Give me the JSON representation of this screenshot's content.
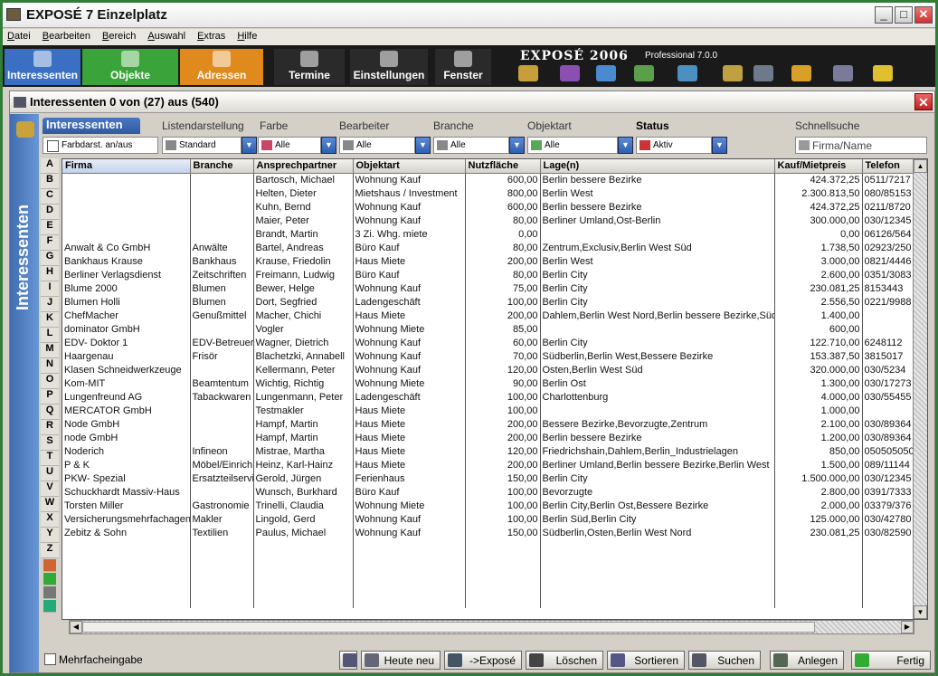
{
  "window": {
    "title": "EXPOSÉ 7 Einzelplatz"
  },
  "menu": [
    "Datei",
    "Bearbeiten",
    "Bereich",
    "Auswahl",
    "Extras",
    "Hilfe"
  ],
  "nav": {
    "tabs": [
      {
        "label": "Interessenten",
        "color": "#3a6fc4"
      },
      {
        "label": "Objekte",
        "color": "#3aa33a"
      },
      {
        "label": "Adressen",
        "color": "#e08a1e"
      },
      {
        "label": "Termine",
        "color": "#2a2a2a"
      },
      {
        "label": "Einstellungen",
        "color": "#2a2a2a"
      },
      {
        "label": "Fenster",
        "color": "#2a2a2a"
      }
    ],
    "brand": "EXPOSÉ 2006",
    "edition": "Professional 7.0.0"
  },
  "subwindow": {
    "title": "Interessenten  0 von (27) aus (540)",
    "side_label": "Interessenten"
  },
  "header": {
    "tab": "Interessenten",
    "labels": [
      "Listendarstellung",
      "Farbe",
      "Bearbeiter",
      "Branche",
      "Objektart",
      "Status",
      "Schnellsuche"
    ]
  },
  "filters": {
    "farbdarst": "Farbdarst. an/aus",
    "standard": "Standard",
    "alle1": "Alle",
    "alle2": "Alle",
    "alle3": "Alle",
    "alle4": "Alle",
    "aktiv": "Aktiv",
    "search_placeholder": "Firma/Name"
  },
  "letters": [
    "A",
    "B",
    "C",
    "D",
    "E",
    "F",
    "G",
    "H",
    "I",
    "J",
    "K",
    "L",
    "M",
    "N",
    "O",
    "P",
    "Q",
    "R",
    "S",
    "T",
    "U",
    "V",
    "W",
    "X",
    "Y",
    "Z"
  ],
  "table": {
    "columns": [
      "Firma",
      "Branche",
      "Ansprechpartner",
      "Objektart",
      "Nutzfläche",
      "Lage(n)",
      "Kauf/Mietpreis",
      "Telefon"
    ],
    "rows": [
      [
        "",
        "",
        "Bartosch, Michael",
        "Wohnung Kauf",
        "600,00",
        "Berlin bessere Bezirke",
        "424.372,25",
        "0511/7217"
      ],
      [
        "",
        "",
        "Helten, Dieter",
        "Mietshaus / Investment",
        "800,00",
        "Berlin West",
        "2.300.813,50",
        "080/85153"
      ],
      [
        "",
        "",
        "Kuhn, Bernd",
        "Wohnung Kauf",
        "600,00",
        "Berlin bessere Bezirke",
        "424.372,25",
        "0211/8720"
      ],
      [
        "",
        "",
        "Maier, Peter",
        "Wohnung Kauf",
        "80,00",
        "Berliner Umland,Ost-Berlin",
        "300.000,00",
        "030/12345"
      ],
      [
        "",
        "",
        "Brandt, Martin",
        "3 Zi. Whg. miete",
        "0,00",
        "",
        "0,00",
        "06126/564"
      ],
      [
        "Anwalt & Co GmbH",
        "Anwälte",
        "Bartel, Andreas",
        "Büro Kauf",
        "80,00",
        "Zentrum,Exclusiv,Berlin West Süd",
        "1.738,50",
        "02923/250"
      ],
      [
        "Bankhaus Krause",
        "Bankhaus",
        "Krause, Friedolin",
        "Haus Miete",
        "200,00",
        "Berlin West",
        "3.000,00",
        "0821/4446"
      ],
      [
        "Berliner Verlagsdienst",
        "Zeitschriften",
        "Freimann, Ludwig",
        "Büro Kauf",
        "80,00",
        "Berlin City",
        "2.600,00",
        "0351/3083"
      ],
      [
        "Blume 2000",
        "Blumen",
        "Bewer, Helge",
        "Wohnung Kauf",
        "75,00",
        "Berlin City",
        "230.081,25",
        "8153443"
      ],
      [
        "Blumen Holli",
        "Blumen",
        "Dort, Segfried",
        "Ladengeschäft",
        "100,00",
        "Berlin City",
        "2.556,50",
        "0221/9988"
      ],
      [
        "ChefMacher",
        "Genußmittel",
        "Macher, Chichi",
        "Haus Miete",
        "200,00",
        "Dahlem,Berlin West Nord,Berlin bessere Bezirke,Süd",
        "1.400,00",
        ""
      ],
      [
        "dominator GmbH",
        "",
        "Vogler",
        "Wohnung Miete",
        "85,00",
        "",
        "600,00",
        ""
      ],
      [
        "EDV- Doktor 1",
        "EDV-Betreuer",
        "Wagner, Dietrich",
        "Wohnung Kauf",
        "60,00",
        "Berlin City",
        "122.710,00",
        "6248112"
      ],
      [
        "Haargenau",
        "Frisör",
        "Blachetzki, Annabell",
        "Wohnung Kauf",
        "70,00",
        "Südberlin,Berlin West,Bessere Bezirke",
        "153.387,50",
        "3815017"
      ],
      [
        "Klasen Schneidwerkzeuge",
        "",
        "Kellermann, Peter",
        "Wohnung Kauf",
        "120,00",
        "Osten,Berlin West Süd",
        "320.000,00",
        "030/5234"
      ],
      [
        "Kom-MIT",
        "Beamtentum",
        "Wichtig, Richtig",
        "Wohnung Miete",
        "90,00",
        "Berlin Ost",
        "1.300,00",
        "030/17273"
      ],
      [
        "Lungenfreund AG",
        "Tabackwaren",
        "Lungenmann, Peter",
        "Ladengeschäft",
        "100,00",
        "Charlottenburg",
        "4.000,00",
        "030/55455"
      ],
      [
        "MERCATOR GmbH",
        "",
        "Testmakler",
        "Haus Miete",
        "100,00",
        "",
        "1.000,00",
        ""
      ],
      [
        "Node GmbH",
        "",
        "Hampf, Martin",
        "Haus Miete",
        "200,00",
        "Bessere Bezirke,Bevorzugte,Zentrum",
        "2.100,00",
        "030/89364"
      ],
      [
        "node GmbH",
        "",
        "Hampf, Martin",
        "Haus Miete",
        "200,00",
        "Berlin bessere Bezirke",
        "1.200,00",
        "030/89364"
      ],
      [
        "Noderich",
        "Infineon",
        "Mistrae, Martha",
        "Haus Miete",
        "120,00",
        "Friedrichshain,Dahlem,Berlin_Industrielagen",
        "850,00",
        "050505050"
      ],
      [
        "P & K",
        "Möbel/Einrich",
        "Heinz, Karl-Hainz",
        "Haus Miete",
        "200,00",
        "Berliner Umland,Berlin bessere Bezirke,Berlin West",
        "1.500,00",
        "089/11144"
      ],
      [
        "PKW- Spezial",
        "Ersatzteilservic",
        "Gerold, Jürgen",
        "Ferienhaus",
        "150,00",
        "Berlin City",
        "1.500.000,00",
        "030/12345"
      ],
      [
        "Schuckhardt Massiv-Haus",
        "",
        "Wunsch, Burkhard",
        "Büro Kauf",
        "100,00",
        "Bevorzugte",
        "2.800,00",
        "0391/7333"
      ],
      [
        "Torsten Miller",
        "Gastronomie",
        "Trinelli, Claudia",
        "Wohnung Miete",
        "100,00",
        "Berlin City,Berlin Ost,Bessere Bezirke",
        "2.000,00",
        "03379/376"
      ],
      [
        "Versicherungsmehrfachagen",
        "Makler",
        "Lingold, Gerd",
        "Wohnung Kauf",
        "100,00",
        "Berlin Süd,Berlin City",
        "125.000,00",
        "030/42780"
      ],
      [
        "Zebitz & Sohn",
        "Textilien",
        "Paulus, Michael",
        "Wohnung Kauf",
        "150,00",
        "Südberlin,Osten,Berlin West Nord",
        "230.081,25",
        "030/82590"
      ]
    ]
  },
  "bottom": {
    "mehrfach": "Mehrfacheingabe",
    "buttons": [
      "Heute neu",
      "->Exposé",
      "Löschen",
      "Sortieren",
      "Suchen",
      "Anlegen",
      "Fertig"
    ]
  }
}
